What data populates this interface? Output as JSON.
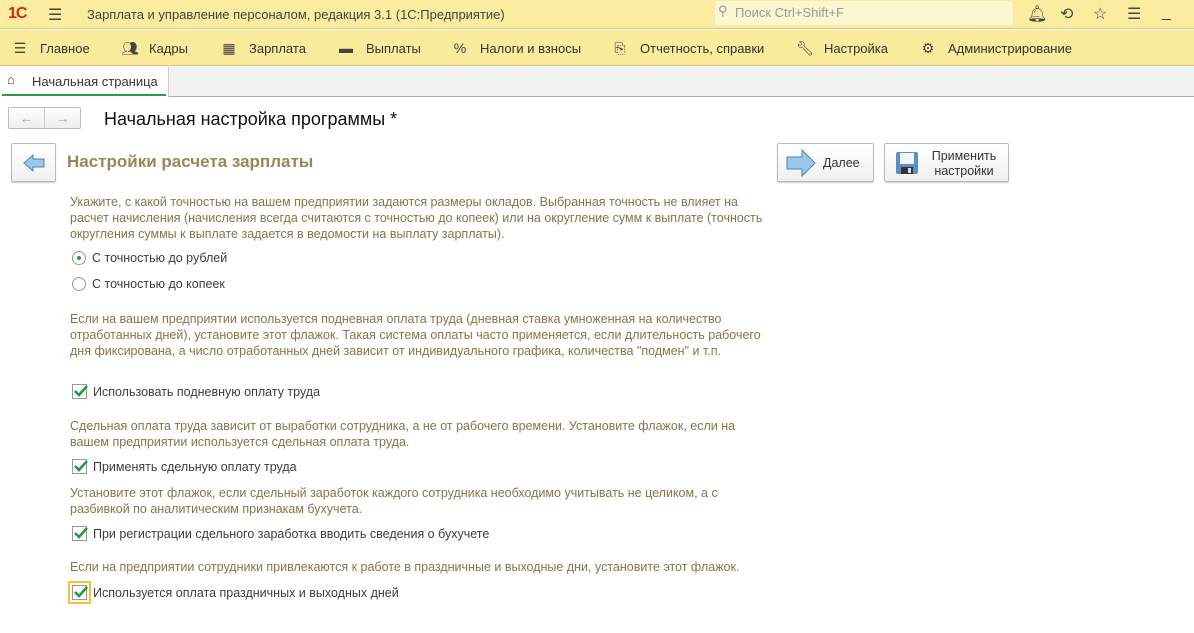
{
  "app": {
    "logo": "1С",
    "title": "Зарплата и управление персоналом, редакция 3.1  (1С:Предприятие)",
    "search_placeholder": "Поиск Ctrl+Shift+F"
  },
  "menu": [
    {
      "label": "Главное",
      "icon": "≡"
    },
    {
      "label": "Кадры",
      "icon": "👥"
    },
    {
      "label": "Зарплата",
      "icon": "▦"
    },
    {
      "label": "Выплаты",
      "icon": "▬"
    },
    {
      "label": "Налоги и взносы",
      "icon": "%"
    },
    {
      "label": "Отчетность, справки",
      "icon": "⎘"
    },
    {
      "label": "Настройка",
      "icon": "🔧"
    },
    {
      "label": "Администрирование",
      "icon": "⚙"
    }
  ],
  "tabs": [
    {
      "label": "Начальная страница"
    }
  ],
  "page": {
    "title": "Начальная настройка программы *",
    "section": "Настройки расчета зарплаты",
    "next_label": "Далее",
    "apply_label_1": "Применить",
    "apply_label_2": "настройки"
  },
  "form": {
    "p1": "Укажите, с какой точностью на вашем предприятии задаются размеры окладов. Выбранная точность не влияет на расчет начисления (начисления всегда считаются с точностью до копеек) или на округление сумм к выплате (точность округления суммы к выплате задается в ведомости на выплату зарплаты).",
    "r1": "С точностью до рублей",
    "r2": "С точностью до копеек",
    "precision_selected": "С точностью до рублей",
    "p2": "Если на вашем предприятии используется подневная оплата труда (дневная ставка умноженная на количество отработанных дней), установите этот флажок. Такая система оплаты часто применяется, если длительность рабочего дня фиксирована, а число отработанных дней зависит от индивидуального графика, количества \"подмен\" и т.п.",
    "c1": "Использовать подневную оплату труда",
    "c1_checked": true,
    "p3": "Сдельная оплата труда зависит от выработки сотрудника, а не от рабочего времени. Установите флажок, если на вашем предприятии используется сдельная оплата труда.",
    "c2": "Применять сдельную оплату труда",
    "c2_checked": true,
    "p4": "Установите этот флажок, если сдельный заработок каждого сотрудника необходимо учитывать не целиком, а с разбивкой по аналитическим признакам бухучета.",
    "c3": "При регистрации сдельного заработка вводить сведения о бухучете",
    "c3_checked": true,
    "p5": "Если на предприятии сотрудники привлекаются к работе в праздничные и выходные дни, установите этот флажок.",
    "c4": "Используется оплата праздничных и выходных дней",
    "c4_checked": true
  }
}
